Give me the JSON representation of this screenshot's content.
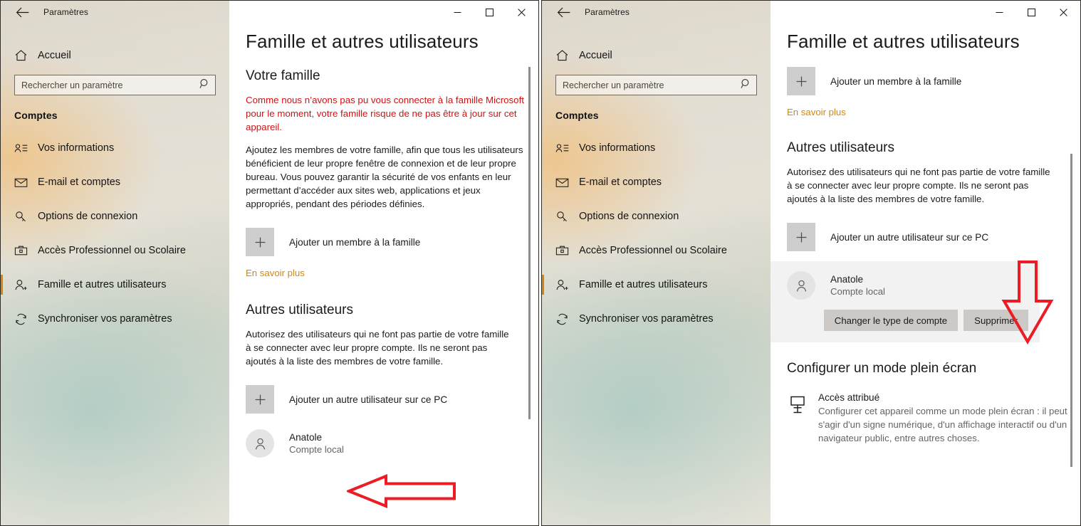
{
  "app": {
    "title": "Paramètres",
    "back_icon": "back-arrow-icon",
    "home_label": "Accueil",
    "home_icon": "home-icon",
    "accent_color": "#d4860b",
    "warning_color": "#d01212",
    "annotation_color": "#ed1c24"
  },
  "search": {
    "placeholder": "Rechercher un paramètre",
    "value": "",
    "icon": "search-icon"
  },
  "sidebar": {
    "section_title": "Comptes",
    "items": [
      {
        "label": "Vos informations",
        "icon": "contact-card-icon",
        "selected": false
      },
      {
        "label": "E-mail et comptes",
        "icon": "mail-icon",
        "selected": false
      },
      {
        "label": "Options de connexion",
        "icon": "key-icon",
        "selected": false
      },
      {
        "label": "Accès Professionnel ou Scolaire",
        "icon": "briefcase-icon",
        "selected": false
      },
      {
        "label": "Famille et autres utilisateurs",
        "icon": "add-user-icon",
        "selected": true
      },
      {
        "label": "Synchroniser vos paramètres",
        "icon": "sync-icon",
        "selected": false
      }
    ]
  },
  "window_controls": {
    "minimize": "minimize-icon",
    "maximize": "maximize-icon",
    "close": "close-icon"
  },
  "left_window": {
    "page_title": "Famille et autres utilisateurs",
    "family": {
      "heading": "Votre famille",
      "warning": "Comme nous n’avons pas pu vous connecter à la famille Microsoft pour le moment, votre famille risque de ne pas être à jour sur cet appareil.",
      "description": "Ajoutez les membres de votre famille, afin que tous les utilisateurs bénéficient de leur propre fenêtre de connexion et de leur propre bureau. Vous pouvez garantir la sécurité de vos enfants en leur permettant d’accéder aux sites web, applications et jeux appropriés, pendant des périodes définies.",
      "add_member_label": "Ajouter un membre à la famille",
      "learn_more_label": "En savoir plus"
    },
    "other_users": {
      "heading": "Autres utilisateurs",
      "description": "Autorisez des utilisateurs qui ne font pas partie de votre famille à se connecter avec leur propre compte. Ils ne seront pas ajoutés à la liste des membres de votre famille.",
      "add_user_label": "Ajouter un autre utilisateur sur ce PC",
      "user": {
        "name": "Anatole",
        "account_type": "Compte local",
        "avatar_icon": "person-icon"
      }
    }
  },
  "right_window": {
    "page_title": "Famille et autres utilisateurs",
    "family": {
      "add_member_label": "Ajouter un membre à la famille",
      "learn_more_label": "En savoir plus"
    },
    "other_users": {
      "heading": "Autres utilisateurs",
      "description": "Autorisez des utilisateurs qui ne font pas partie de votre famille à se connecter avec leur propre compte. Ils ne seront pas ajoutés à la liste des membres de votre famille.",
      "add_user_label": "Ajouter un autre utilisateur sur ce PC",
      "user": {
        "name": "Anatole",
        "account_type": "Compte local",
        "avatar_icon": "person-icon"
      },
      "change_account_type_label": "Changer le type de compte",
      "remove_label": "Supprimer"
    },
    "kiosk": {
      "heading": "Configurer un mode plein écran",
      "title": "Accès attribué",
      "icon": "kiosk-display-icon",
      "description": "Configurer cet appareil comme un mode plein écran : il peut s'agir d'un signe numérique, d'un affichage interactif ou d'un navigateur public, entre autres choses."
    }
  },
  "annotations": [
    {
      "name": "left-arrow-to-user",
      "direction": "left"
    },
    {
      "name": "down-arrow-to-remove-button",
      "direction": "down"
    }
  ]
}
